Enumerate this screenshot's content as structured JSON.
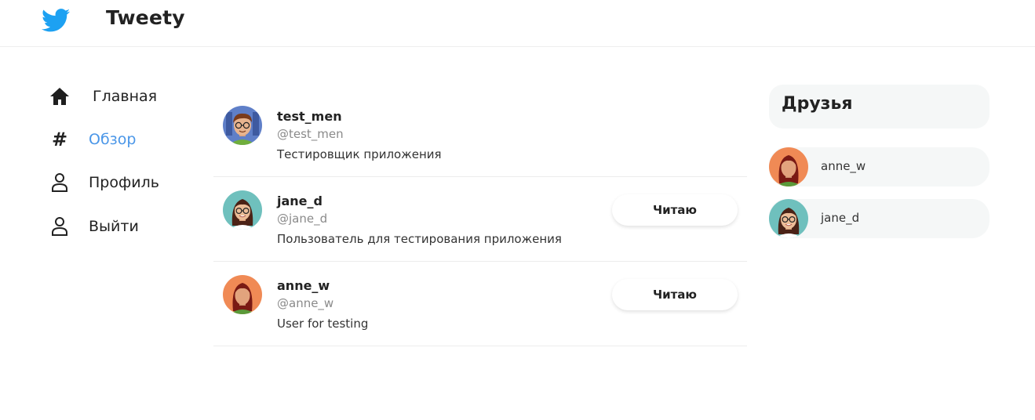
{
  "app": {
    "title": "Tweety",
    "accent": "#4a96e8",
    "logo_color": "#1da1f2"
  },
  "sidebar": {
    "items": [
      {
        "label": "Главная",
        "icon": "home-icon"
      },
      {
        "label": "Обзор",
        "icon": "hash-icon",
        "active": true
      },
      {
        "label": "Профиль",
        "icon": "user-icon"
      },
      {
        "label": "Выйти",
        "icon": "user-icon"
      }
    ]
  },
  "feed": {
    "users": [
      {
        "name": "test_men",
        "handle": "@test_men",
        "bio": "Тестировщик приложения"
      },
      {
        "name": "jane_d",
        "handle": "@jane_d",
        "bio": "Пользователь для тестирования приложения",
        "button": "Читаю"
      },
      {
        "name": "anne_w",
        "handle": "@anne_w",
        "bio": "User for testing",
        "button": "Читаю"
      }
    ]
  },
  "friends": {
    "title": "Друзья",
    "items": [
      {
        "name": "anne_w"
      },
      {
        "name": "jane_d"
      }
    ]
  }
}
